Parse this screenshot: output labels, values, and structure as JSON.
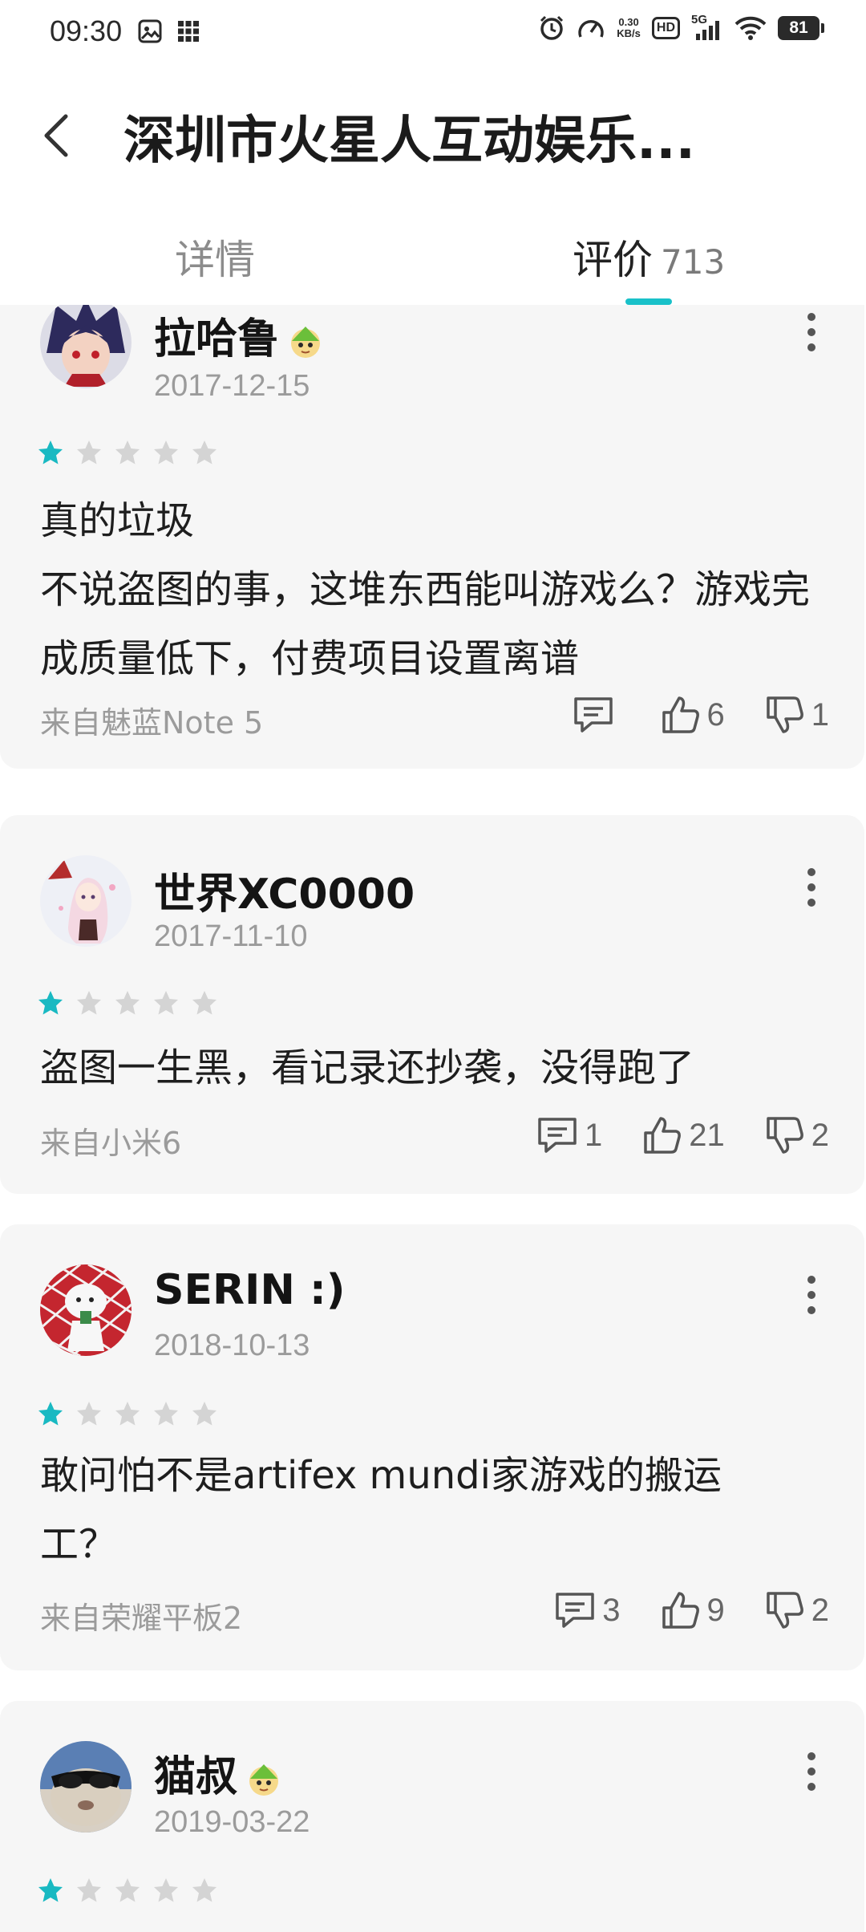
{
  "status_bar": {
    "time": "09:30",
    "net_speed_value": "0.30",
    "net_speed_unit": "KB/s",
    "hd_label": "HD",
    "network_label": "5G",
    "battery": "81",
    "icons": [
      "gallery-icon",
      "grid-apps-icon",
      "alarm-icon",
      "speedometer-icon",
      "signal-icon",
      "wifi-icon",
      "battery-icon"
    ]
  },
  "header": {
    "title": "深圳市火星人互动娱乐...",
    "back_icon": "chevron-left-icon"
  },
  "tabs": {
    "details": "详情",
    "reviews": "评价",
    "reviews_count": "713",
    "active": "reviews",
    "accent": "#19c1c9"
  },
  "star_colors": {
    "filled": "#19b9c2",
    "empty": "#d4d4d4"
  },
  "reviews": [
    {
      "username": "拉哈鲁",
      "date": "2017-12-15",
      "rating": 1,
      "text": "真的垃圾\n不说盗图的事，这堆东西能叫游戏么？游戏完成质量低下，付费项目设置离谱",
      "device": "来自魅蓝Note 5",
      "comments": "",
      "likes": "6",
      "dislikes": "1"
    },
    {
      "username": "世界XC0000",
      "date": "2017-11-10",
      "rating": 1,
      "text": "盗图一生黑，看记录还抄袭，没得跑了",
      "device": "来自小米6",
      "comments": "1",
      "likes": "21",
      "dislikes": "2"
    },
    {
      "username": "SERIN :)",
      "date": "2018-10-13",
      "rating": 1,
      "text": "敢问怕不是artifex mundi家游戏的搬运工？",
      "device": "来自荣耀平板2",
      "comments": "3",
      "likes": "9",
      "dislikes": "2"
    },
    {
      "username": "猫叔",
      "date": "2019-03-22",
      "rating": 1
    }
  ]
}
